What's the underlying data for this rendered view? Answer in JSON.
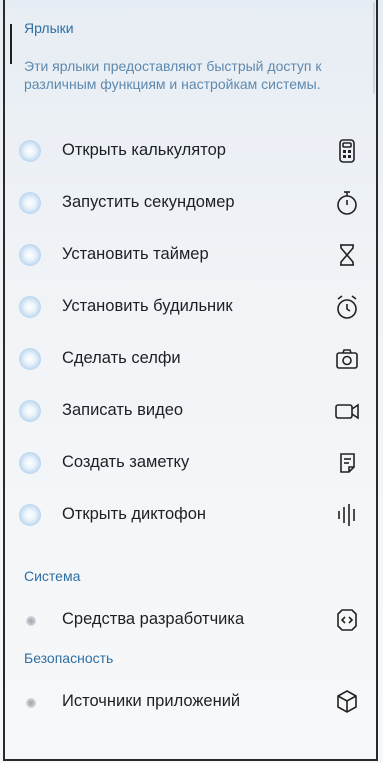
{
  "shortcuts": {
    "title": "Ярлыки",
    "description": "Эти ярлыки предоставляют быстрый доступ к различным функциям и настройкам системы.",
    "items": [
      {
        "label": "Открыть калькулятор",
        "icon": "calculator-icon"
      },
      {
        "label": "Запустить секундомер",
        "icon": "stopwatch-icon"
      },
      {
        "label": "Установить таймер",
        "icon": "hourglass-icon"
      },
      {
        "label": "Установить будильник",
        "icon": "alarm-clock-icon"
      },
      {
        "label": "Сделать селфи",
        "icon": "camera-icon"
      },
      {
        "label": "Записать видео",
        "icon": "video-camera-icon"
      },
      {
        "label": "Создать заметку",
        "icon": "note-icon"
      },
      {
        "label": "Открыть диктофон",
        "icon": "voice-recorder-icon"
      }
    ]
  },
  "system": {
    "title": "Система",
    "items": [
      {
        "label": "Средства разработчика",
        "icon": "developer-tools-icon"
      }
    ]
  },
  "security": {
    "title": "Безопасность",
    "items": [
      {
        "label": "Источники приложений",
        "icon": "app-package-icon"
      }
    ]
  },
  "colors": {
    "section_title": "#2f6fa3",
    "description": "#5e89ae",
    "text": "#1d2024",
    "background": "#eef2f6"
  }
}
